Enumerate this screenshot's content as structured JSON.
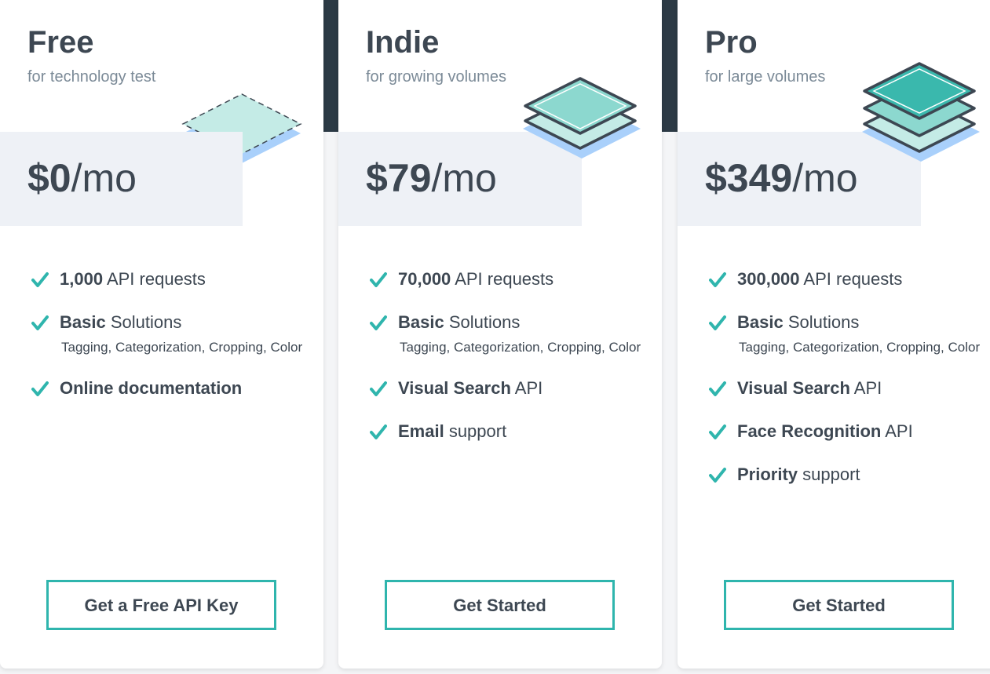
{
  "plans": [
    {
      "name": "Free",
      "subtitle": "for technology test",
      "price_amount": "$0",
      "price_period": "/mo",
      "features": [
        {
          "bold": "1,000",
          "rest": " API requests",
          "detail": ""
        },
        {
          "bold": "Basic",
          "rest": " Solutions",
          "detail": "Tagging, Categorization, Cropping, Color"
        },
        {
          "bold": "Online documentation",
          "rest": "",
          "detail": ""
        }
      ],
      "cta_label": "Get a Free API Key",
      "icon": "single-layer-outline-icon"
    },
    {
      "name": "Indie",
      "subtitle": "for growing volumes",
      "price_amount": "$79",
      "price_period": "/mo",
      "features": [
        {
          "bold": "70,000",
          "rest": " API requests",
          "detail": ""
        },
        {
          "bold": "Basic",
          "rest": " Solutions",
          "detail": "Tagging, Categorization, Cropping, Color"
        },
        {
          "bold": "Visual Search",
          "rest": " API",
          "detail": ""
        },
        {
          "bold": "Email",
          "rest": " support",
          "detail": ""
        }
      ],
      "cta_label": "Get Started",
      "icon": "two-layer-stack-icon"
    },
    {
      "name": "Pro",
      "subtitle": "for large volumes",
      "price_amount": "$349",
      "price_period": "/mo",
      "features": [
        {
          "bold": "300,000",
          "rest": " API requests",
          "detail": ""
        },
        {
          "bold": "Basic",
          "rest": " Solutions",
          "detail": "Tagging, Categorization, Cropping, Color"
        },
        {
          "bold": "Visual Search",
          "rest": " API",
          "detail": ""
        },
        {
          "bold": "Face Recognition",
          "rest": " API",
          "detail": ""
        },
        {
          "bold": "Priority",
          "rest": " support",
          "detail": ""
        }
      ],
      "cta_label": "Get Started",
      "icon": "three-layer-stack-icon"
    }
  ],
  "colors": {
    "accent": "#2fb5ad",
    "header_dark": "#2c3a45",
    "text": "#3d4752",
    "subtext": "#7b8a97",
    "price_band": "#eef1f6"
  }
}
